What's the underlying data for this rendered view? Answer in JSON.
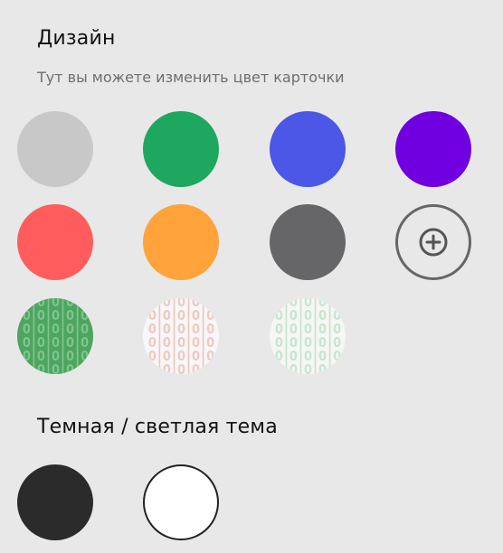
{
  "design": {
    "title": "Дизайн",
    "subtitle": "Тут вы можете изменить цвет карточки",
    "colors": [
      "#c8c8c8",
      "#1ea75f",
      "#4a57e7",
      "#7000e0",
      "#ff5d5d",
      "#ffa33a",
      "#666669"
    ],
    "add_button": {
      "icon": "plus-circle-icon"
    },
    "pattern_swatches": [
      {
        "name": "green-pattern",
        "background": "#4da55f",
        "pattern_text": "O|O|O|O|O"
      },
      {
        "name": "light-multicolor-pattern",
        "background": "#f7f7f7",
        "pattern_text": "O|O|O|O|O"
      },
      {
        "name": "light-green-pattern",
        "background": "#f4f7f4",
        "pattern_text": "O|O|O|O|O"
      }
    ]
  },
  "theme": {
    "title": "Темная / светлая тема",
    "options": [
      {
        "name": "dark",
        "color": "#2b2b2b"
      },
      {
        "name": "light",
        "color": "#ffffff"
      }
    ]
  }
}
